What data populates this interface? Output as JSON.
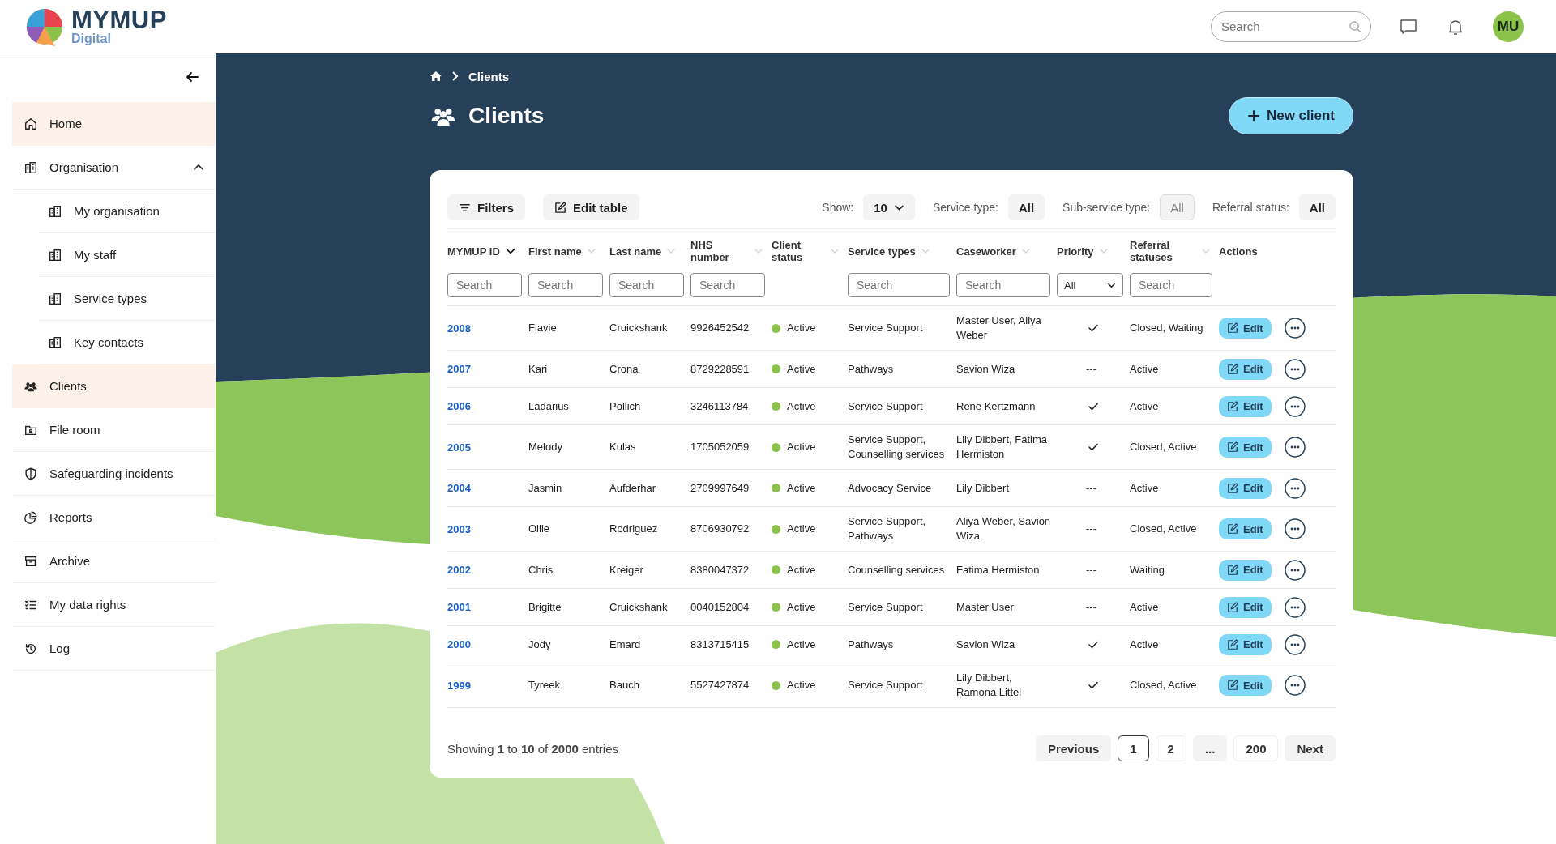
{
  "header": {
    "logo": {
      "name": "MYMUP",
      "tagline": "Digital"
    },
    "search": {
      "placeholder": "Search"
    },
    "avatar": "MU"
  },
  "sidebar": {
    "items": [
      {
        "label": "Home",
        "selected": true
      },
      {
        "label": "Organisation",
        "selected": false,
        "expanded": true,
        "children": [
          {
            "label": "My organisation",
            "selected": false
          },
          {
            "label": "My staff",
            "selected": false
          },
          {
            "label": "Service types",
            "selected": false
          },
          {
            "label": "Key contacts",
            "selected": false
          }
        ]
      },
      {
        "label": "Clients",
        "selected": true
      },
      {
        "label": "File room",
        "selected": false
      },
      {
        "label": "Safeguarding incidents",
        "selected": false
      },
      {
        "label": "Reports",
        "selected": false
      },
      {
        "label": "Archive",
        "selected": false
      },
      {
        "label": "My data rights",
        "selected": false
      },
      {
        "label": "Log",
        "selected": false
      }
    ]
  },
  "breadcrumb": [
    "Clients"
  ],
  "page_title": "Clients",
  "new_button": "New client",
  "toolbar": {
    "filters_button": "Filters",
    "edit_table_button": "Edit table",
    "selects": [
      {
        "label": "Show:",
        "value": "10",
        "kind": "dropdown",
        "disabled": false
      },
      {
        "label": "Service type:",
        "value": "All",
        "kind": "pill",
        "disabled": false
      },
      {
        "label": "Sub-service type:",
        "value": "All",
        "kind": "pill",
        "disabled": true
      },
      {
        "label": "Referral status:",
        "value": "All",
        "kind": "pill",
        "disabled": false
      }
    ]
  },
  "table": {
    "columns": [
      {
        "label": "MYMUP ID",
        "sorted": true,
        "filter": {
          "kind": "search",
          "placeholder": "Search"
        }
      },
      {
        "label": "First name",
        "sorted": false,
        "filter": {
          "kind": "search",
          "placeholder": "Search"
        }
      },
      {
        "label": "Last name",
        "sorted": false,
        "filter": {
          "kind": "search",
          "placeholder": "Search"
        }
      },
      {
        "label": "NHS number",
        "sorted": false,
        "filter": {
          "kind": "search",
          "placeholder": "Search"
        }
      },
      {
        "label": "Client status",
        "sorted": false
      },
      {
        "label": "Service types",
        "sorted": false,
        "filter": {
          "kind": "search",
          "placeholder": "Search"
        }
      },
      {
        "label": "Caseworker",
        "sorted": false,
        "filter": {
          "kind": "search",
          "placeholder": "Search"
        }
      },
      {
        "label": "Priority",
        "sorted": false,
        "filter": {
          "kind": "select",
          "value": "All"
        }
      },
      {
        "label": "Referral statuses",
        "sorted": false,
        "filter": {
          "kind": "search",
          "placeholder": "Search"
        }
      },
      {
        "label": "Actions"
      }
    ],
    "rows": [
      {
        "id": "2008",
        "first_name": "Flavie",
        "last_name": "Cruickshank",
        "nhs": "9926452542",
        "status": {
          "label": "Active",
          "color": "#8bc34a"
        },
        "service_types": "Service Support",
        "caseworker": "Master User, Aliya Weber",
        "priority": true,
        "referral": "Closed, Waiting",
        "edit": "Edit"
      },
      {
        "id": "2007",
        "first_name": "Kari",
        "last_name": "Crona",
        "nhs": "8729228591",
        "status": {
          "label": "Active",
          "color": "#8bc34a"
        },
        "service_types": "Pathways",
        "caseworker": "Savion Wiza",
        "priority": false,
        "priority_placeholder": "---",
        "referral": "Active",
        "edit": "Edit"
      },
      {
        "id": "2006",
        "first_name": "Ladarius",
        "last_name": "Pollich",
        "nhs": "3246113784",
        "status": {
          "label": "Active",
          "color": "#8bc34a"
        },
        "service_types": "Service Support",
        "caseworker": "Rene Kertzmann",
        "priority": true,
        "referral": "Active",
        "edit": "Edit"
      },
      {
        "id": "2005",
        "first_name": "Melody",
        "last_name": "Kulas",
        "nhs": "1705052059",
        "status": {
          "label": "Active",
          "color": "#8bc34a"
        },
        "service_types": "Service Support, Counselling services",
        "caseworker": "Lily Dibbert, Fatima Hermiston",
        "priority": true,
        "referral": "Closed, Active",
        "edit": "Edit"
      },
      {
        "id": "2004",
        "first_name": "Jasmin",
        "last_name": "Aufderhar",
        "nhs": "2709997649",
        "status": {
          "label": "Active",
          "color": "#8bc34a"
        },
        "service_types": "Advocacy Service",
        "caseworker": "Lily Dibbert",
        "priority": false,
        "priority_placeholder": "---",
        "referral": "Active",
        "edit": "Edit"
      },
      {
        "id": "2003",
        "first_name": "Ollie",
        "last_name": "Rodriguez",
        "nhs": "8706930792",
        "status": {
          "label": "Active",
          "color": "#8bc34a"
        },
        "service_types": "Service Support, Pathways",
        "caseworker": "Aliya Weber, Savion Wiza",
        "priority": false,
        "priority_placeholder": "---",
        "referral": "Closed, Active",
        "edit": "Edit"
      },
      {
        "id": "2002",
        "first_name": "Chris",
        "last_name": "Kreiger",
        "nhs": "8380047372",
        "status": {
          "label": "Active",
          "color": "#8bc34a"
        },
        "service_types": "Counselling services",
        "caseworker": "Fatima Hermiston",
        "priority": false,
        "priority_placeholder": "---",
        "referral": "Waiting",
        "edit": "Edit"
      },
      {
        "id": "2001",
        "first_name": "Brigitte",
        "last_name": "Cruickshank",
        "nhs": "0040152804",
        "status": {
          "label": "Active",
          "color": "#8bc34a"
        },
        "service_types": "Service Support",
        "caseworker": "Master User",
        "priority": false,
        "priority_placeholder": "---",
        "referral": "Active",
        "edit": "Edit"
      },
      {
        "id": "2000",
        "first_name": "Jody",
        "last_name": "Emard",
        "nhs": "8313715415",
        "status": {
          "label": "Active",
          "color": "#8bc34a"
        },
        "service_types": "Pathways",
        "caseworker": "Savion Wiza",
        "priority": true,
        "referral": "Active",
        "edit": "Edit"
      },
      {
        "id": "1999",
        "first_name": "Tyreek",
        "last_name": "Bauch",
        "nhs": "5527427874",
        "status": {
          "label": "Active",
          "color": "#8bc34a"
        },
        "service_types": "Service Support",
        "caseworker": "Lily Dibbert, Ramona Littel",
        "priority": true,
        "referral": "Closed, Active",
        "edit": "Edit"
      }
    ]
  },
  "footer": {
    "summary": "Showing **1** to **10** of **2000** entries",
    "pagination": [
      {
        "label": "Previous",
        "kind": "nav",
        "selected": false
      },
      {
        "label": "1",
        "kind": "page",
        "selected": true
      },
      {
        "label": "2",
        "kind": "page",
        "selected": false
      },
      {
        "label": "...",
        "kind": "gap",
        "selected": false
      },
      {
        "label": "200",
        "kind": "page",
        "selected": false
      },
      {
        "label": "Next",
        "kind": "nav",
        "selected": false
      }
    ]
  }
}
